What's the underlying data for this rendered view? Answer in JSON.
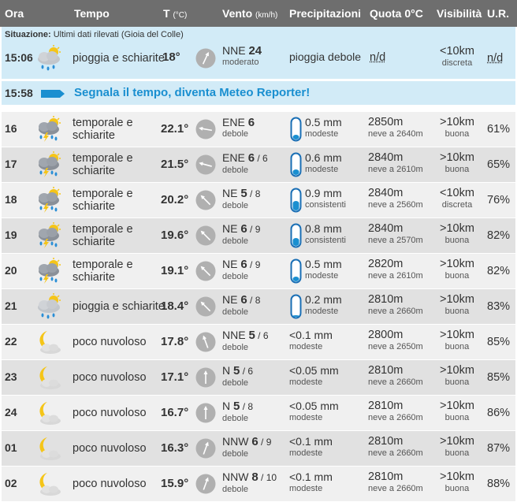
{
  "header": {
    "ora": "Ora",
    "tempo": "Tempo",
    "temp": "T",
    "temp_unit": "(°C)",
    "vento": "Vento",
    "vento_unit": "(km/h)",
    "precipitazioni": "Precipitazioni",
    "quota": "Quota 0°C",
    "visibilita": "Visibilità",
    "ur": "U.R."
  },
  "situazione": {
    "label": "Situazione:",
    "text": "Ultimi dati rilevati (Gioia del Colle)",
    "ora": "15:06",
    "icon": "rain-sun-icon",
    "desc": "pioggia e schiarite",
    "temp": "18°",
    "wind_dir": "NNE",
    "wind_speed": "24",
    "wind_desc": "moderato",
    "prec": "pioggia debole",
    "quota": "n/d",
    "vis": "<10km",
    "vis_desc": "discreta",
    "ur": "n/d"
  },
  "reporter": {
    "ora": "15:58",
    "text": "Segnala il tempo, diventa Meteo Reporter!"
  },
  "rows": [
    {
      "ora": "16",
      "icon": "thunderstorm-icon",
      "desc1": "temporale e",
      "desc2": "schiarite",
      "temp": "22.1°",
      "dir": "ENE",
      "spd": "6",
      "gust": "",
      "wdesc": "debole",
      "prec": "0.5 mm",
      "pdesc": "modeste",
      "fill": 0.25,
      "quota": "2850m",
      "neve": "neve a 2640m",
      "vis": ">10km",
      "vdesc": "buona",
      "ur": "61%",
      "angle": 100
    },
    {
      "ora": "17",
      "icon": "thunderstorm-icon",
      "desc1": "temporale e",
      "desc2": "schiarite",
      "temp": "21.5°",
      "dir": "ENE",
      "spd": "6",
      "gust": "6",
      "wdesc": "debole",
      "prec": "0.6 mm",
      "pdesc": "modeste",
      "fill": 0.3,
      "quota": "2840m",
      "neve": "neve a 2610m",
      "vis": ">10km",
      "vdesc": "buona",
      "ur": "65%",
      "angle": 105
    },
    {
      "ora": "18",
      "icon": "thunderstorm-icon",
      "desc1": "temporale e",
      "desc2": "schiarite",
      "temp": "20.2°",
      "dir": "NE",
      "spd": "5",
      "gust": "8",
      "wdesc": "debole",
      "prec": "0.9 mm",
      "pdesc": "consistenti",
      "fill": 0.45,
      "quota": "2840m",
      "neve": "neve a 2560m",
      "vis": "<10km",
      "vdesc": "discreta",
      "ur": "76%",
      "angle": 135
    },
    {
      "ora": "19",
      "icon": "thunderstorm-icon",
      "desc1": "temporale e",
      "desc2": "schiarite",
      "temp": "19.6°",
      "dir": "NE",
      "spd": "6",
      "gust": "9",
      "wdesc": "debole",
      "prec": "0.8 mm",
      "pdesc": "consistenti",
      "fill": 0.4,
      "quota": "2840m",
      "neve": "neve a 2570m",
      "vis": ">10km",
      "vdesc": "buona",
      "ur": "82%",
      "angle": 135
    },
    {
      "ora": "20",
      "icon": "thunderstorm-icon",
      "desc1": "temporale e",
      "desc2": "schiarite",
      "temp": "19.1°",
      "dir": "NE",
      "spd": "6",
      "gust": "9",
      "wdesc": "debole",
      "prec": "0.5 mm",
      "pdesc": "modeste",
      "fill": 0.25,
      "quota": "2820m",
      "neve": "neve a 2610m",
      "vis": ">10km",
      "vdesc": "buona",
      "ur": "82%",
      "angle": 135
    },
    {
      "ora": "21",
      "icon": "rain-sun-icon",
      "desc1": "pioggia e schiarite",
      "desc2": "",
      "temp": "18.4°",
      "dir": "NE",
      "spd": "6",
      "gust": "8",
      "wdesc": "debole",
      "prec": "0.2 mm",
      "pdesc": "modeste",
      "fill": 0.12,
      "quota": "2810m",
      "neve": "neve a 2660m",
      "vis": ">10km",
      "vdesc": "buona",
      "ur": "83%",
      "angle": 135
    },
    {
      "ora": "22",
      "icon": "moon-cloud-icon",
      "desc1": "poco nuvoloso",
      "desc2": "",
      "temp": "17.8°",
      "dir": "NNE",
      "spd": "5",
      "gust": "6",
      "wdesc": "debole",
      "prec": "<0.1 mm",
      "pdesc": "modeste",
      "fill": -1,
      "quota": "2800m",
      "neve": "neve a 2650m",
      "vis": ">10km",
      "vdesc": "buona",
      "ur": "85%",
      "angle": 160
    },
    {
      "ora": "23",
      "icon": "moon-cloud-icon",
      "desc1": "poco nuvoloso",
      "desc2": "",
      "temp": "17.1°",
      "dir": "N",
      "spd": "5",
      "gust": "6",
      "wdesc": "debole",
      "prec": "<0.05 mm",
      "pdesc": "modeste",
      "fill": -1,
      "quota": "2810m",
      "neve": "neve a 2660m",
      "vis": ">10km",
      "vdesc": "buona",
      "ur": "85%",
      "angle": 180
    },
    {
      "ora": "24",
      "icon": "moon-cloud-icon",
      "desc1": "poco nuvoloso",
      "desc2": "",
      "temp": "16.7°",
      "dir": "N",
      "spd": "5",
      "gust": "8",
      "wdesc": "debole",
      "prec": "<0.05 mm",
      "pdesc": "modeste",
      "fill": -1,
      "quota": "2810m",
      "neve": "neve a 2660m",
      "vis": ">10km",
      "vdesc": "buona",
      "ur": "86%",
      "angle": 180
    },
    {
      "ora": "01",
      "icon": "moon-cloud-icon",
      "desc1": "poco nuvoloso",
      "desc2": "",
      "temp": "16.3°",
      "dir": "NNW",
      "spd": "6",
      "gust": "9",
      "wdesc": "debole",
      "prec": "<0.1 mm",
      "pdesc": "modeste",
      "fill": -1,
      "quota": "2810m",
      "neve": "neve a 2660m",
      "vis": ">10km",
      "vdesc": "buona",
      "ur": "87%",
      "angle": 200
    },
    {
      "ora": "02",
      "icon": "moon-cloud-icon",
      "desc1": "poco nuvoloso",
      "desc2": "",
      "temp": "15.9°",
      "dir": "NNW",
      "spd": "8",
      "gust": "10",
      "wdesc": "debole",
      "prec": "<0.1 mm",
      "pdesc": "modeste",
      "fill": -1,
      "quota": "2810m",
      "neve": "neve a 2660m",
      "vis": ">10km",
      "vdesc": "buona",
      "ur": "88%",
      "angle": 200
    }
  ],
  "colors": {
    "header_bg": "#6e6e6e",
    "row_even": "#f0f0f0",
    "row_odd": "#e1e1e1",
    "now_bg": "#d2ebf7",
    "accent": "#1a8fd0"
  }
}
